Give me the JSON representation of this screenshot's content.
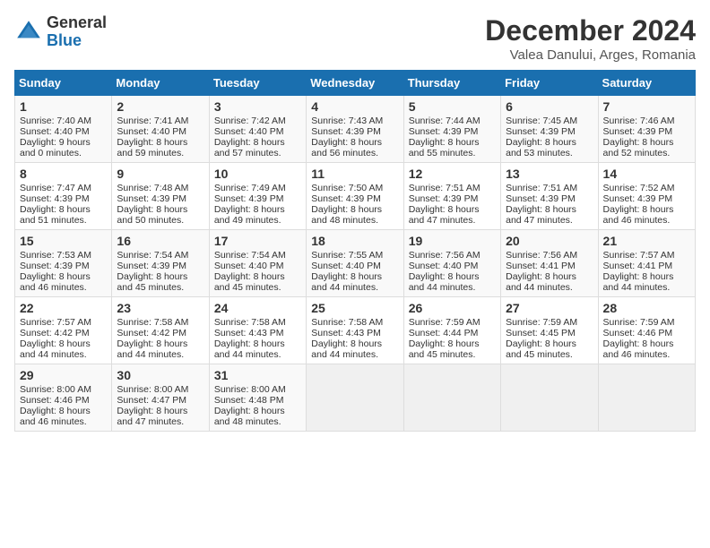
{
  "logo": {
    "general": "General",
    "blue": "Blue"
  },
  "title": "December 2024",
  "location": "Valea Danului, Arges, Romania",
  "days_of_week": [
    "Sunday",
    "Monday",
    "Tuesday",
    "Wednesday",
    "Thursday",
    "Friday",
    "Saturday"
  ],
  "weeks": [
    [
      {
        "day": "1",
        "sunrise": "Sunrise: 7:40 AM",
        "sunset": "Sunset: 4:40 PM",
        "daylight": "Daylight: 9 hours and 0 minutes."
      },
      {
        "day": "2",
        "sunrise": "Sunrise: 7:41 AM",
        "sunset": "Sunset: 4:40 PM",
        "daylight": "Daylight: 8 hours and 59 minutes."
      },
      {
        "day": "3",
        "sunrise": "Sunrise: 7:42 AM",
        "sunset": "Sunset: 4:40 PM",
        "daylight": "Daylight: 8 hours and 57 minutes."
      },
      {
        "day": "4",
        "sunrise": "Sunrise: 7:43 AM",
        "sunset": "Sunset: 4:39 PM",
        "daylight": "Daylight: 8 hours and 56 minutes."
      },
      {
        "day": "5",
        "sunrise": "Sunrise: 7:44 AM",
        "sunset": "Sunset: 4:39 PM",
        "daylight": "Daylight: 8 hours and 55 minutes."
      },
      {
        "day": "6",
        "sunrise": "Sunrise: 7:45 AM",
        "sunset": "Sunset: 4:39 PM",
        "daylight": "Daylight: 8 hours and 53 minutes."
      },
      {
        "day": "7",
        "sunrise": "Sunrise: 7:46 AM",
        "sunset": "Sunset: 4:39 PM",
        "daylight": "Daylight: 8 hours and 52 minutes."
      }
    ],
    [
      {
        "day": "8",
        "sunrise": "Sunrise: 7:47 AM",
        "sunset": "Sunset: 4:39 PM",
        "daylight": "Daylight: 8 hours and 51 minutes."
      },
      {
        "day": "9",
        "sunrise": "Sunrise: 7:48 AM",
        "sunset": "Sunset: 4:39 PM",
        "daylight": "Daylight: 8 hours and 50 minutes."
      },
      {
        "day": "10",
        "sunrise": "Sunrise: 7:49 AM",
        "sunset": "Sunset: 4:39 PM",
        "daylight": "Daylight: 8 hours and 49 minutes."
      },
      {
        "day": "11",
        "sunrise": "Sunrise: 7:50 AM",
        "sunset": "Sunset: 4:39 PM",
        "daylight": "Daylight: 8 hours and 48 minutes."
      },
      {
        "day": "12",
        "sunrise": "Sunrise: 7:51 AM",
        "sunset": "Sunset: 4:39 PM",
        "daylight": "Daylight: 8 hours and 47 minutes."
      },
      {
        "day": "13",
        "sunrise": "Sunrise: 7:51 AM",
        "sunset": "Sunset: 4:39 PM",
        "daylight": "Daylight: 8 hours and 47 minutes."
      },
      {
        "day": "14",
        "sunrise": "Sunrise: 7:52 AM",
        "sunset": "Sunset: 4:39 PM",
        "daylight": "Daylight: 8 hours and 46 minutes."
      }
    ],
    [
      {
        "day": "15",
        "sunrise": "Sunrise: 7:53 AM",
        "sunset": "Sunset: 4:39 PM",
        "daylight": "Daylight: 8 hours and 46 minutes."
      },
      {
        "day": "16",
        "sunrise": "Sunrise: 7:54 AM",
        "sunset": "Sunset: 4:39 PM",
        "daylight": "Daylight: 8 hours and 45 minutes."
      },
      {
        "day": "17",
        "sunrise": "Sunrise: 7:54 AM",
        "sunset": "Sunset: 4:40 PM",
        "daylight": "Daylight: 8 hours and 45 minutes."
      },
      {
        "day": "18",
        "sunrise": "Sunrise: 7:55 AM",
        "sunset": "Sunset: 4:40 PM",
        "daylight": "Daylight: 8 hours and 44 minutes."
      },
      {
        "day": "19",
        "sunrise": "Sunrise: 7:56 AM",
        "sunset": "Sunset: 4:40 PM",
        "daylight": "Daylight: 8 hours and 44 minutes."
      },
      {
        "day": "20",
        "sunrise": "Sunrise: 7:56 AM",
        "sunset": "Sunset: 4:41 PM",
        "daylight": "Daylight: 8 hours and 44 minutes."
      },
      {
        "day": "21",
        "sunrise": "Sunrise: 7:57 AM",
        "sunset": "Sunset: 4:41 PM",
        "daylight": "Daylight: 8 hours and 44 minutes."
      }
    ],
    [
      {
        "day": "22",
        "sunrise": "Sunrise: 7:57 AM",
        "sunset": "Sunset: 4:42 PM",
        "daylight": "Daylight: 8 hours and 44 minutes."
      },
      {
        "day": "23",
        "sunrise": "Sunrise: 7:58 AM",
        "sunset": "Sunset: 4:42 PM",
        "daylight": "Daylight: 8 hours and 44 minutes."
      },
      {
        "day": "24",
        "sunrise": "Sunrise: 7:58 AM",
        "sunset": "Sunset: 4:43 PM",
        "daylight": "Daylight: 8 hours and 44 minutes."
      },
      {
        "day": "25",
        "sunrise": "Sunrise: 7:58 AM",
        "sunset": "Sunset: 4:43 PM",
        "daylight": "Daylight: 8 hours and 44 minutes."
      },
      {
        "day": "26",
        "sunrise": "Sunrise: 7:59 AM",
        "sunset": "Sunset: 4:44 PM",
        "daylight": "Daylight: 8 hours and 45 minutes."
      },
      {
        "day": "27",
        "sunrise": "Sunrise: 7:59 AM",
        "sunset": "Sunset: 4:45 PM",
        "daylight": "Daylight: 8 hours and 45 minutes."
      },
      {
        "day": "28",
        "sunrise": "Sunrise: 7:59 AM",
        "sunset": "Sunset: 4:46 PM",
        "daylight": "Daylight: 8 hours and 46 minutes."
      }
    ],
    [
      {
        "day": "29",
        "sunrise": "Sunrise: 8:00 AM",
        "sunset": "Sunset: 4:46 PM",
        "daylight": "Daylight: 8 hours and 46 minutes."
      },
      {
        "day": "30",
        "sunrise": "Sunrise: 8:00 AM",
        "sunset": "Sunset: 4:47 PM",
        "daylight": "Daylight: 8 hours and 47 minutes."
      },
      {
        "day": "31",
        "sunrise": "Sunrise: 8:00 AM",
        "sunset": "Sunset: 4:48 PM",
        "daylight": "Daylight: 8 hours and 48 minutes."
      },
      null,
      null,
      null,
      null
    ]
  ]
}
